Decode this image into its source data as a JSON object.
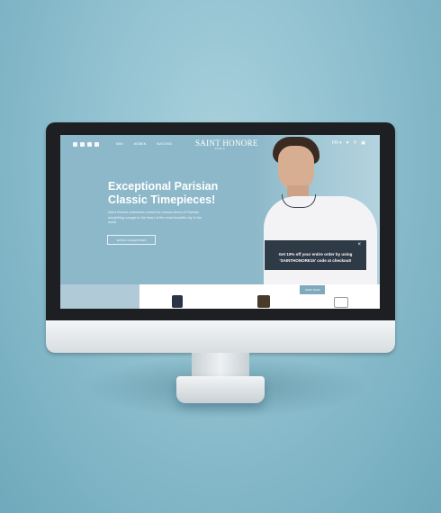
{
  "nav": {
    "social": [
      "facebook",
      "twitter",
      "youtube",
      "instagram"
    ],
    "menu": [
      "MEN",
      "WOMEN",
      "WATCHES"
    ],
    "logo": "SAINT HONORE",
    "logo_sub": "PARIS",
    "lang": "FR ▾",
    "icons": [
      "heart-icon",
      "search-icon",
      "cart-icon"
    ]
  },
  "hero": {
    "title_line1": "Exceptional Parisian",
    "title_line2": "Classic Timepieces!",
    "paragraph": "Saint Honore collections reveal the various faces of Parisian storytelling voyage to the heart of the most beautiful city in the world.",
    "cta_label": "WATCH COLLECTIONS"
  },
  "popup": {
    "line1": "Get 10% off your entire order by using",
    "line2": "'SAINTHONORE15' code at checkout!",
    "close": "×"
  },
  "products": {
    "shop_label": "SHOP NOW"
  }
}
